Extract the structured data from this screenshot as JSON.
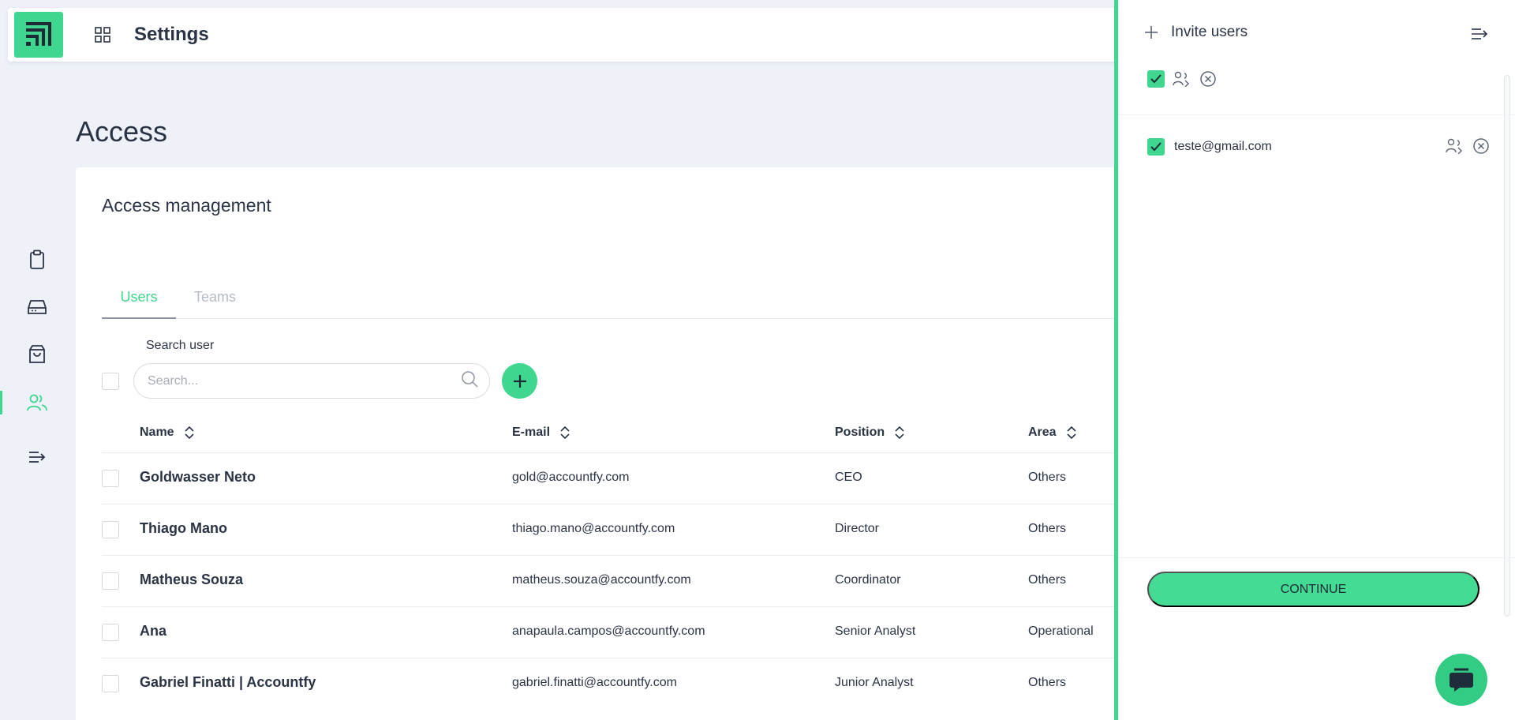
{
  "topbar": {
    "title": "Settings"
  },
  "nav": {
    "items": [
      "clipboard-icon",
      "drive-icon",
      "bag-icon",
      "users-icon",
      "menu-icon"
    ],
    "active": "users-icon"
  },
  "page": {
    "heading": "Access"
  },
  "card": {
    "title": "Access management",
    "tabs": [
      {
        "label": "Users",
        "active": true
      },
      {
        "label": "Teams",
        "active": false
      }
    ],
    "search": {
      "label": "Search user",
      "placeholder": "Search..."
    },
    "columns": {
      "name": "Name",
      "email": "E-mail",
      "position": "Position",
      "area": "Area"
    },
    "rows": [
      {
        "name": "Goldwasser Neto",
        "email": "gold@accountfy.com",
        "position": "CEO",
        "area": "Others"
      },
      {
        "name": "Thiago Mano",
        "email": "thiago.mano@accountfy.com",
        "position": "Director",
        "area": "Others"
      },
      {
        "name": "Matheus Souza",
        "email": "matheus.souza@accountfy.com",
        "position": "Coordinator",
        "area": "Others"
      },
      {
        "name": "Ana",
        "email": "anapaula.campos@accountfy.com",
        "position": "Senior Analyst",
        "area": "Operational"
      },
      {
        "name": "Gabriel Finatti | Accountfy",
        "email": "gabriel.finatti@accountfy.com",
        "position": "Junior Analyst",
        "area": "Others"
      }
    ]
  },
  "panel": {
    "title": "Invite users",
    "invites": [
      {
        "email": "teste@gmail.com",
        "checked": true
      }
    ],
    "continue_label": "CONTINUE"
  },
  "colors": {
    "accent": "#3fd68f",
    "text": "#2b3445",
    "background": "#eef1f8"
  }
}
